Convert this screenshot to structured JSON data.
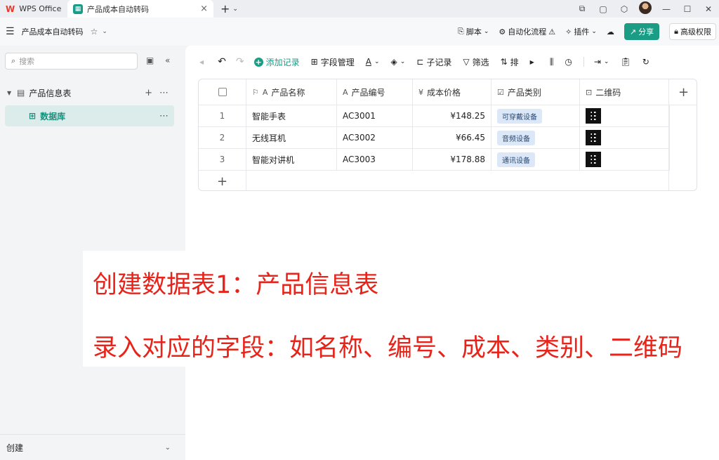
{
  "titlebar": {
    "home_tab": "WPS Office",
    "doc_tab": "产品成本自动转码",
    "close_glyph": "×",
    "new_tab_glyph": "+"
  },
  "docbar": {
    "doc_title": "产品成本自动转码",
    "script": "脚本",
    "automation": "自动化流程",
    "plugins": "插件",
    "share": "分享",
    "permissions": "高级权限"
  },
  "sidebar": {
    "search_placeholder": "搜索",
    "table_name": "产品信息表",
    "database": "数据库",
    "create": "创建"
  },
  "toolbar": {
    "add_record": "添加记录",
    "field_manage": "字段管理",
    "sub_record": "子记录",
    "filter": "筛选",
    "sort": "排"
  },
  "grid": {
    "columns": [
      "产品名称",
      "产品编号",
      "成本价格",
      "产品类别",
      "二维码"
    ],
    "rows": [
      {
        "idx": "1",
        "name": "智能手表",
        "code": "AC3001",
        "price": "¥148.25",
        "category": "可穿戴设备"
      },
      {
        "idx": "2",
        "name": "无线耳机",
        "code": "AC3002",
        "price": "¥66.45",
        "category": "音频设备"
      },
      {
        "idx": "3",
        "name": "智能对讲机",
        "code": "AC3003",
        "price": "¥178.88",
        "category": "通讯设备"
      }
    ],
    "add_row_glyph": "+",
    "add_col_glyph": "+"
  },
  "overlay": {
    "line1": "创建数据表1：产品信息表",
    "line2": "录入对应的字段：如名称、编号、成本、类别、二维码"
  },
  "colors": {
    "accent": "#1b9c85",
    "annotation": "#e8231a",
    "tag_bg": "#dce8f8"
  }
}
